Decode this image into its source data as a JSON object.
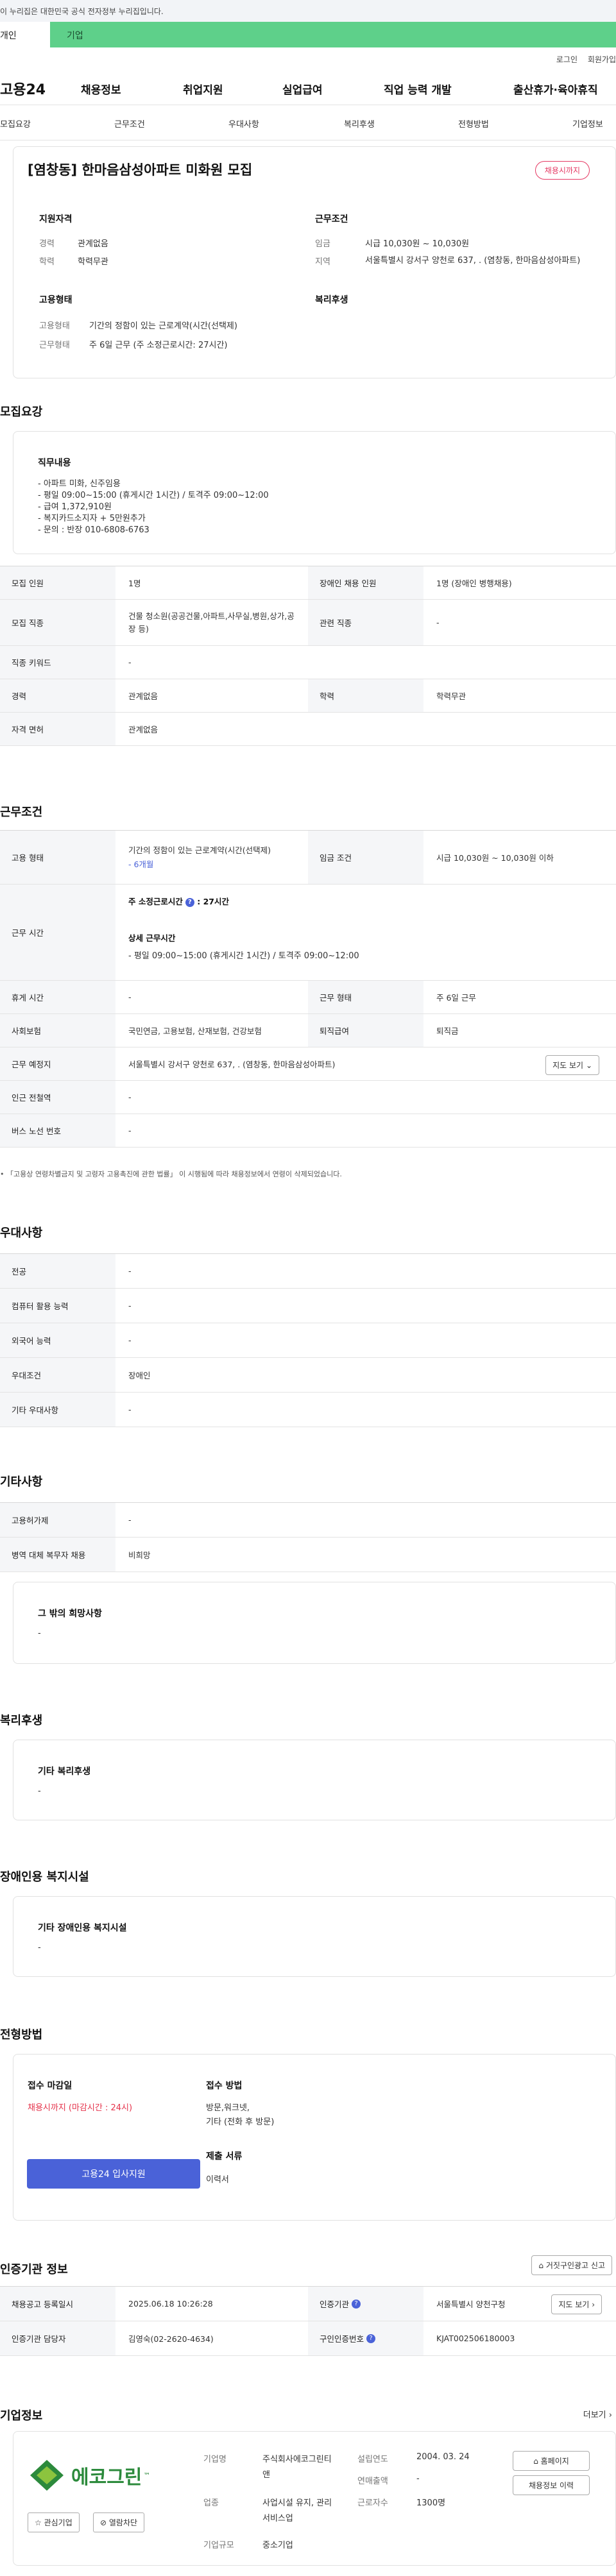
{
  "gov_banner": "이 누리집은 대한민국 공식 전자정부 누리집입니다.",
  "tabs": {
    "personal": "개인",
    "company": "기업"
  },
  "util": {
    "login": "로그인",
    "signup": "회원가입"
  },
  "gnb": {
    "logo": "고용24",
    "menu": [
      "채용정보",
      "취업지원",
      "실업급여",
      "직업 능력 개발",
      "출산휴가·육아휴직"
    ]
  },
  "subnav": [
    "모집요강",
    "근무조건",
    "우대사항",
    "복리후생",
    "전형방법",
    "기업정보"
  ],
  "summary": {
    "title": "[염창동] 한마음삼성아파트 미화원 모집",
    "badge": "채용시까지",
    "qual_header": "지원자격",
    "career_label": "경력",
    "career_value": "관계없음",
    "edu_label": "학력",
    "edu_value": "학력무관",
    "cond_header": "근무조건",
    "wage_label": "임금",
    "wage_value": "시급 10,030원 ~ 10,030원",
    "region_label": "지역",
    "region_value": "서울특별시 강서구 양천로 637, . (염창동, 한마음삼성아파트)",
    "type_header": "고용형태",
    "emp_label": "고용형태",
    "emp_value": "기간의 정함이 있는 근로계약(시간(선택제)",
    "work_label": "근무형태",
    "work_value": "주 6일 근무 (주 소정근로시간: 27시간)",
    "welfare_header": "복리후생"
  },
  "recruit": {
    "title": "모집요강",
    "duty_header": "직무내용",
    "duty_lines": [
      "- 아파트 미화, 신주임용",
      "- 평일 09:00~15:00 (휴게시간 1시간) / 토격주 09:00~12:00",
      "- 급여 1,372,910원",
      "- 복지카드소지자 + 5만원추가",
      "- 문의 : 반장  010-6808-6763"
    ],
    "rows": [
      {
        "h1": "모집 인원",
        "v1": "1명",
        "h2": "장애인 채용 인원",
        "v2": "1명 (장애인 병행채용)"
      },
      {
        "h1": "모집 직종",
        "v1": "건물 청소원(공공건물,아파트,사무실,병원,상가,공장 등)",
        "h2": "관련 직종",
        "v2": "-"
      },
      {
        "h1": "직종 키워드",
        "v1": "-",
        "h2": "",
        "v2": ""
      },
      {
        "h1": "경력",
        "v1": "관계없음",
        "h2": "학력",
        "v2": "학력무관"
      },
      {
        "h1": "자격 면허",
        "v1": "관계없음",
        "h2": "",
        "v2": ""
      }
    ]
  },
  "conditions": {
    "title": "근무조건",
    "emp_h": "고용 형태",
    "emp_v": "기간의 정함이 있는 근로계약(시간(선택제)",
    "emp_v2": "- 6개월",
    "wage_h": "임금 조건",
    "wage_v": "시급 10,030원 ~ 10,030원 이하",
    "hours_h": "근무 시간",
    "hours_week_label": "주 소정근로시간",
    "hours_week_value": "27시간",
    "hours_detail_label": "상세 근무시간",
    "hours_detail": "- 평일 09:00~15:00 (휴게시간 1시간) / 토격주 09:00~12:00",
    "break_h": "휴게 시간",
    "break_v": "-",
    "form_h": "근무 형태",
    "form_v": "주 6일 근무",
    "ins_h": "사회보험",
    "ins_v": "국민연금, 고용보험, 산재보험, 건강보험",
    "ret_h": "퇴직급여",
    "ret_v": "퇴직금",
    "place_h": "근무 예정지",
    "place_v": "서울특별시 강서구 양천로 637, . (염창동, 한마음삼성아파트)",
    "map_btn": "지도 보기",
    "subway_h": "인근 전철역",
    "subway_v": "-",
    "bus_h": "버스 노선 번호",
    "bus_v": "-",
    "note": "「고용상 연령차별금지 및 고령자 고용촉진에 관한 법률」 이 시행됨에 따라 채용정보에서 연령이 삭제되었습니다."
  },
  "prefer": {
    "title": "우대사항",
    "rows": [
      [
        "전공",
        "-"
      ],
      [
        "컴퓨터 활용 능력",
        "-"
      ],
      [
        "외국어 능력",
        "-"
      ],
      [
        "우대조건",
        "장애인"
      ],
      [
        "기타 우대사항",
        "-"
      ]
    ]
  },
  "etc": {
    "title": "기타사항",
    "rows": [
      [
        "고용허가제",
        "-"
      ],
      [
        "병역 대체 복무자 채용",
        "비희망"
      ]
    ],
    "box_header": "그 밖의 희망사항",
    "box_value": "-"
  },
  "welfare": {
    "title": "복리후생",
    "box_header": "기타 복리후생",
    "box_value": "-"
  },
  "disabled": {
    "title": "장애인용 복지시설",
    "box_header": "기타 장애인용 복지시설",
    "box_value": "-"
  },
  "selection": {
    "title": "전형방법",
    "deadline_h": "접수 마감일",
    "deadline_v": "채용시까지 (마감시간 : 24시)",
    "apply_btn": "고용24 입사지원",
    "method_h": "접수 방법",
    "method_v1": "방문,워크넷,",
    "method_v2": "기타 (전화 후 방문)",
    "docs_h": "제출 서류",
    "docs_v": "이력서"
  },
  "cert": {
    "title": "인증기관 정보",
    "report_btn": "거짓구인광고 신고",
    "reg_h": "채용공고 등록일시",
    "reg_v": "2025.06.18 10:26:28",
    "agency_h": "인증기관",
    "agency_v": "서울특별시 양천구청",
    "map_btn": "지도 보기",
    "manager_h": "인증기관 담당자",
    "manager_v": "김영숙(02-2620-4634)",
    "num_h": "구인인증번호",
    "num_v": "KJAT002506180003"
  },
  "company": {
    "title": "기업정보",
    "more": "더보기",
    "logo_text": "에코그린",
    "fav_btn": "관심기업",
    "block_btn": "열람차단",
    "name_h": "기업명",
    "name_v": "주식회사에코그린티앤",
    "ind_h": "업종",
    "ind_v": "사업시설 유지, 관리 서비스업",
    "size_h": "기업규모",
    "size_v": "중소기업",
    "est_h": "설립연도",
    "est_v": "2004. 03. 24",
    "sales_h": "연매출액",
    "sales_v": "-",
    "emp_h": "근로자수",
    "emp_v": "1300명",
    "home_btn": "홈페이지",
    "jobs_btn": "채용정보 이력"
  }
}
